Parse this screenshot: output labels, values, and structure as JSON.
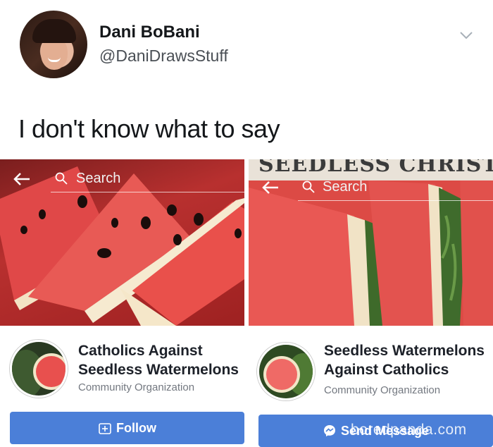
{
  "tweet": {
    "display_name": "Dani BoBani",
    "handle": "@DaniDrawsStuff",
    "text": "I don't know what to say",
    "menu_icon": "chevron-down-icon"
  },
  "left_card": {
    "search_placeholder": "Search",
    "title": "Catholics Against\nSeedless Watermelons",
    "category": "Community Organization",
    "button_label": "Follow",
    "button_icon": "follow-plus-icon",
    "button_color": "#4b7fd8"
  },
  "right_card": {
    "banner_text": "SEEDLESS CHRIST",
    "search_placeholder": "Search",
    "title": "Seedless Watermelons\nAgainst Catholics",
    "category": "Community Organization",
    "button_label": "Send Message",
    "button_icon": "messenger-icon",
    "button_color": "#4b7fd8"
  },
  "watermark": "boredpanda.com"
}
